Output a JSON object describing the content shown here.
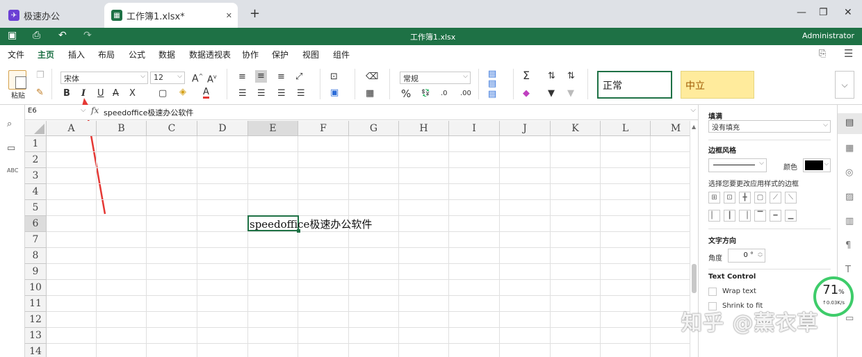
{
  "browser": {
    "tabs": [
      {
        "label": "极速办公"
      },
      {
        "label": "工作簿1.xlsx*",
        "close": "✕"
      }
    ],
    "new_tab": "+"
  },
  "titlebar": {
    "title": "工作簿1.xlsx",
    "user": "Administrator"
  },
  "menu": [
    "文件",
    "主页",
    "插入",
    "布局",
    "公式",
    "数据",
    "数据透视表",
    "协作",
    "保护",
    "视图",
    "组件"
  ],
  "ribbon": {
    "paste_label": "粘贴",
    "font_name": "宋体",
    "font_size": "12",
    "format": "常规",
    "style_normal": "正常",
    "style_neutral": "中立",
    "bold": "B",
    "italic": "I",
    "underline": "U",
    "strike": "A",
    "subscript": "X",
    "sigma": "Σ",
    "percent": "%"
  },
  "formula": {
    "cell_ref": "E6",
    "fx": "fx",
    "content": "speedoffice极速办公软件"
  },
  "sheet": {
    "columns": [
      "A",
      "B",
      "C",
      "D",
      "E",
      "F",
      "G",
      "H",
      "I",
      "J",
      "K",
      "L",
      "M"
    ],
    "rows": [
      "1",
      "2",
      "3",
      "4",
      "5",
      "6",
      "7",
      "8",
      "9",
      "10",
      "11",
      "12",
      "13",
      "14"
    ],
    "active_cell": "E6",
    "cell_e6": "speedoffice极速办公软件"
  },
  "panel": {
    "fill_title": "填满",
    "fill_value": "没有填充",
    "border_style_title": "边框风格",
    "color_label": "颜色",
    "border_hint": "选择您要更改应用样式的边框",
    "text_direction_title": "文字方向",
    "angle_label": "角度",
    "angle_value": "0 °",
    "text_control_title": "Text Control",
    "wrap_text": "Wrap text",
    "shrink_to_fit": "Shrink to fit"
  },
  "speed_widget": {
    "percent": "71",
    "unit": "%",
    "rate": "↑0.03K/s"
  },
  "watermark": "知乎 @薰衣草",
  "colors": {
    "brand_green": "#1e7145",
    "annotation_red": "#e53935",
    "neutral_fill": "#ffeb9c"
  }
}
